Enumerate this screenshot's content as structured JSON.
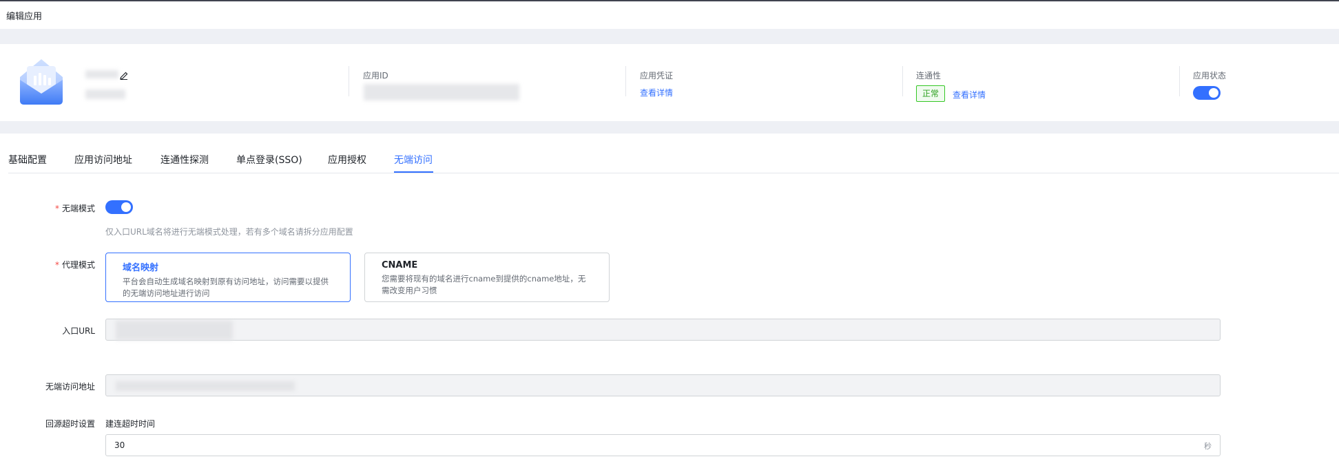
{
  "page": {
    "title": "编辑应用"
  },
  "app_header": {
    "app_icon": "mail-envelope-icon",
    "edit_icon": "edit-pencil-icon",
    "fields": {
      "app_id_label": "应用ID",
      "credential_label": "应用凭证",
      "credential_link": "查看详情",
      "connectivity_label": "连通性",
      "connectivity_status": "正常",
      "connectivity_link": "查看详情",
      "app_status_label": "应用状态",
      "app_status_enabled": true
    }
  },
  "tabs": [
    {
      "label": "基础配置",
      "active": false
    },
    {
      "label": "应用访问地址",
      "active": false
    },
    {
      "label": "连通性探测",
      "active": false
    },
    {
      "label": "单点登录(SSO)",
      "active": false
    },
    {
      "label": "应用授权",
      "active": false
    },
    {
      "label": "无端访问",
      "active": true
    }
  ],
  "form": {
    "clientless_mode": {
      "label": "无端模式",
      "enabled": true,
      "hint": "仅入口URL域名将进行无端模式处理，若有多个域名请拆分应用配置"
    },
    "proxy_mode": {
      "label": "代理模式",
      "options": [
        {
          "title": "域名映射",
          "desc": "平台会自动生成域名映射到原有访问地址，访问需要以提供的无端访问地址进行访问",
          "selected": true
        },
        {
          "title": "CNAME",
          "desc": "您需要将现有的域名进行cname到提供的cname地址，无需改变用户习惯",
          "selected": false
        }
      ]
    },
    "entry_url": {
      "label": "入口URL"
    },
    "clientless_url": {
      "label": "无端访问地址"
    },
    "origin_timeout": {
      "label": "回源超时设置",
      "sub_label": "建连超时时间",
      "value": "30",
      "unit": "秒"
    }
  },
  "colors": {
    "accent": "#3370ff",
    "success": "#2ea121",
    "required": "#f54a45"
  }
}
